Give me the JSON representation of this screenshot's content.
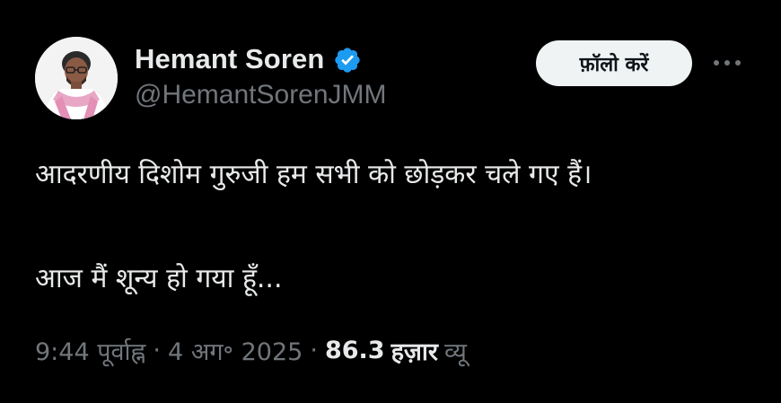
{
  "author": {
    "display_name": "Hemant Soren",
    "handle": "@HemantSorenJMM",
    "verified_icon": "verified-badge-icon",
    "avatar": "profile-photo"
  },
  "actions": {
    "follow_label": "फ़ॉलो करें",
    "more_icon": "more-horizontal-icon"
  },
  "tweet": {
    "lines": [
      "आदरणीय दिशोम गुरुजी हम सभी को छोड़कर चले गए हैं।",
      "",
      "आज मैं शून्य हो गया हूँ..."
    ]
  },
  "meta": {
    "time": "9:44 पूर्वाह्न",
    "date": "4 अग॰ 2025",
    "views_count": "86.3",
    "views_unit": "हज़ार",
    "views_label": "व्यू",
    "separator": "·"
  },
  "colors": {
    "background": "#000000",
    "text": "#e7e9ea",
    "secondary_text": "#71767b",
    "verified_blue": "#1d9bf0",
    "follow_bg": "#eff3f4"
  }
}
